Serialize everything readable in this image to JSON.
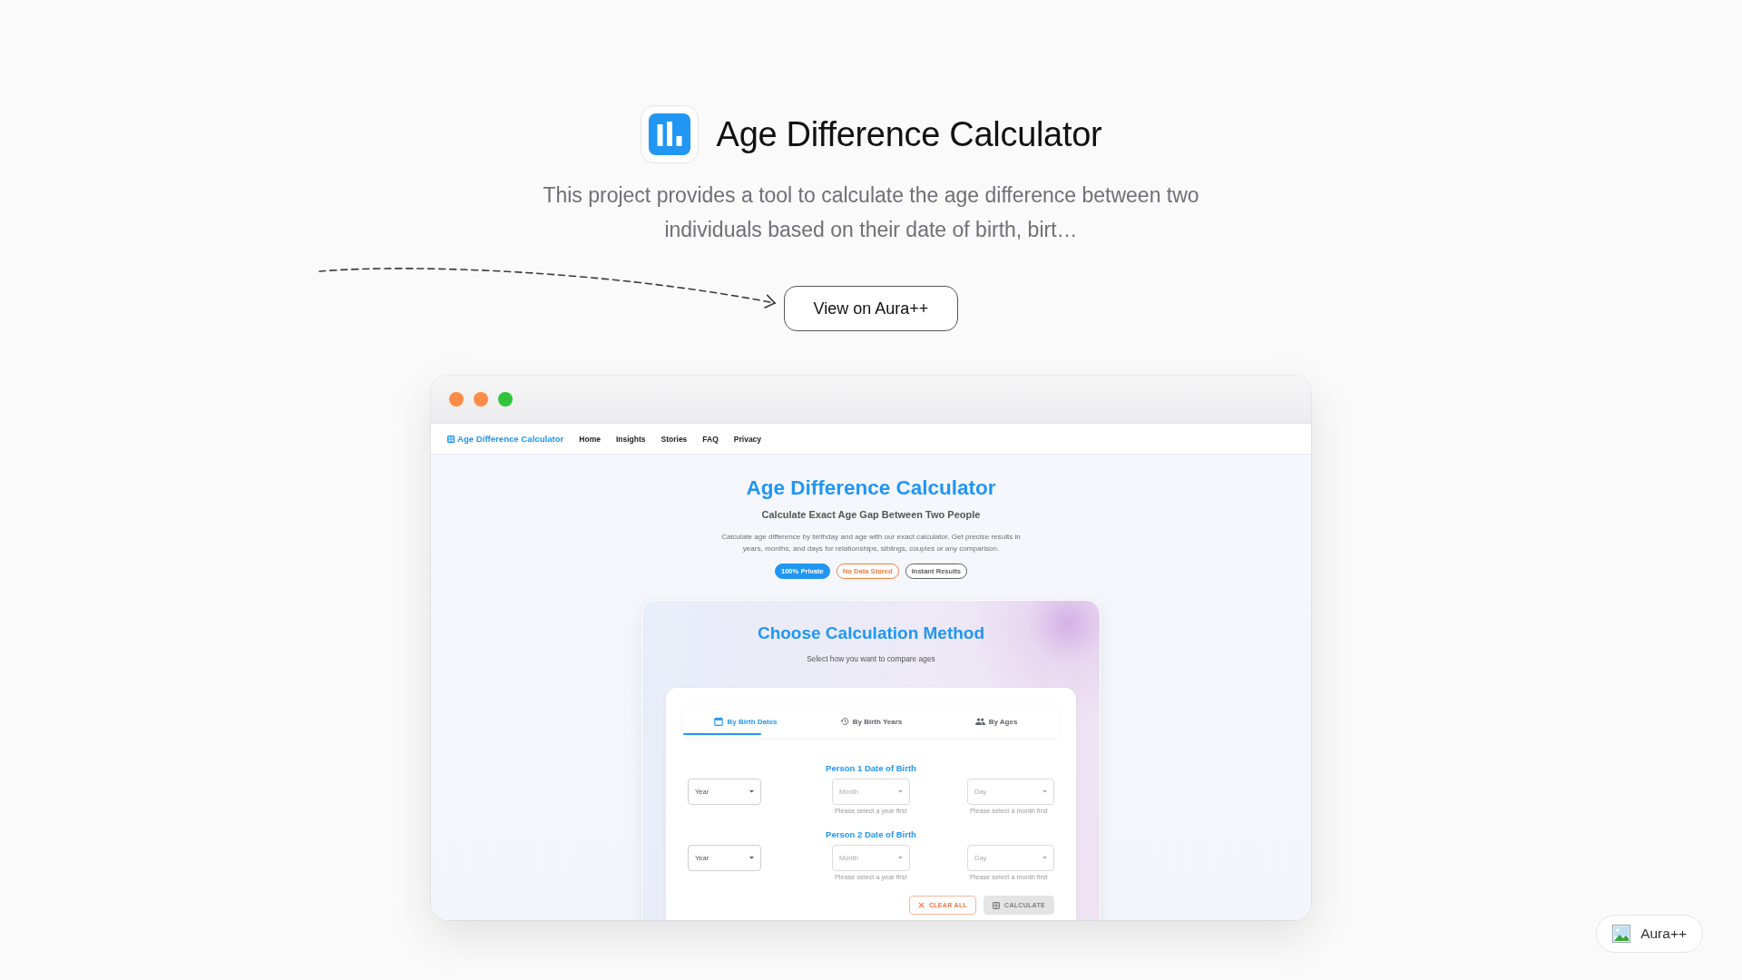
{
  "header": {
    "title": "Age Difference Calculator",
    "description": "This project provides a tool to calculate the age difference between two individuals based on their date of birth, birt…",
    "button": "View on Aura++"
  },
  "browser": {
    "traffic_lights": [
      {
        "color": "#fd8c48"
      },
      {
        "color": "#fd8c48"
      },
      {
        "color": "#30c43c"
      }
    ],
    "nav": {
      "brand": "Age Difference Calculator",
      "links": [
        "Home",
        "Insights",
        "Stories",
        "FAQ",
        "Privacy"
      ]
    },
    "hero": {
      "title": "Age Difference Calculator",
      "subtitle": "Calculate Exact Age Gap Between Two People",
      "description": "Calculate age difference by birthday and age with our exact calculator. Get precise results in years, months, and days for relationships, siblings, couples or any comparison.",
      "badges": [
        {
          "label": "100% Private",
          "kind": "filled",
          "color": "#2196f3"
        },
        {
          "label": "No Data Stored",
          "kind": "outlined",
          "color": "#f47b3c"
        },
        {
          "label": "Instant Results",
          "kind": "outlined",
          "color": "#5f5f5f"
        }
      ]
    },
    "method_card": {
      "title": "Choose Calculation Method",
      "subtitle": "Select how you want to compare ages",
      "tabs": [
        {
          "label": "By Birth Dates",
          "selected": true
        },
        {
          "label": "By Birth Years",
          "selected": false
        },
        {
          "label": "By Ages",
          "selected": false
        }
      ],
      "persons": [
        {
          "heading": "Person 1 Date of Birth",
          "fields": [
            {
              "placeholder": "Year",
              "disabled": false
            },
            {
              "placeholder": "Month",
              "disabled": true,
              "helper": "Please select a year first"
            },
            {
              "placeholder": "Day",
              "disabled": true,
              "helper": "Please select a month first"
            }
          ]
        },
        {
          "heading": "Person 2 Date of Birth",
          "fields": [
            {
              "placeholder": "Year",
              "disabled": false
            },
            {
              "placeholder": "Month",
              "disabled": true,
              "helper": "Please select a year first"
            },
            {
              "placeholder": "Day",
              "disabled": true,
              "helper": "Please select a month first"
            }
          ]
        }
      ],
      "actions": [
        {
          "label": "CLEAR ALL",
          "kind": "outlined",
          "disabled": false
        },
        {
          "label": "CALCULATE",
          "kind": "contained",
          "disabled": true
        }
      ]
    }
  },
  "corner_link": {
    "label": "Aura++"
  }
}
